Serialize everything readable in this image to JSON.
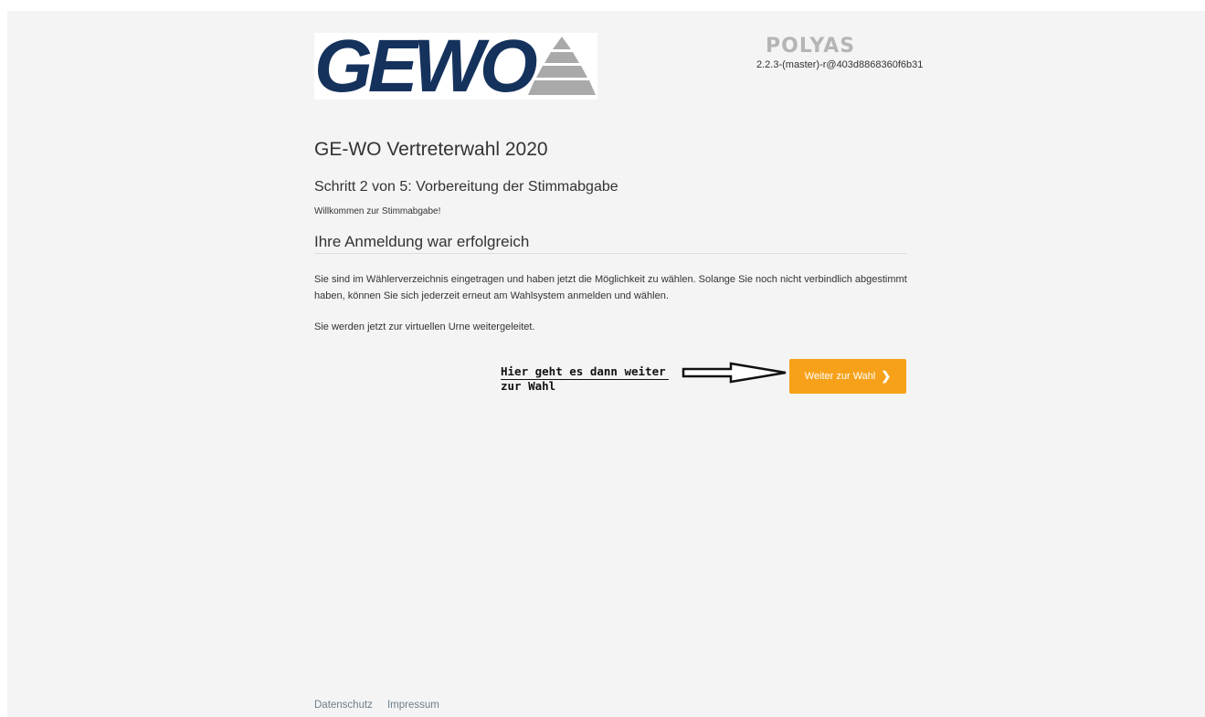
{
  "logo": {
    "text": "GEWO"
  },
  "polyas": {
    "name": "POLYAS",
    "version": "2.2.3-(master)-r@403d8868360f6b31"
  },
  "election_title": "GE-WO Vertreterwahl 2020",
  "step_heading": "Schritt 2 von 5: Vorbereitung der Stimmabgabe",
  "welcome_text": "Willkommen zur Stimmabgabe!",
  "login_heading": "Ihre Anmeldung war erfolgreich",
  "info_paragraph": "Sie sind im Wählerverzeichnis eingetragen und haben jetzt die Möglichkeit zu wählen. Solange Sie noch nicht verbindlich abgestimmt haben, können Sie sich jederzeit erneut am Wahlsystem anmelden und wählen.",
  "redirect_text": "Sie werden jetzt zur virtuellen Urne weitergeleitet.",
  "annotation": {
    "text": "Hier geht es dann weiter zur Wahl"
  },
  "next_button": {
    "label": "Weiter zur Wahl",
    "icon": "chevron-right-icon",
    "color": "#f7a11a"
  },
  "footer": {
    "links": [
      "Datenschutz",
      "Impressum"
    ]
  }
}
